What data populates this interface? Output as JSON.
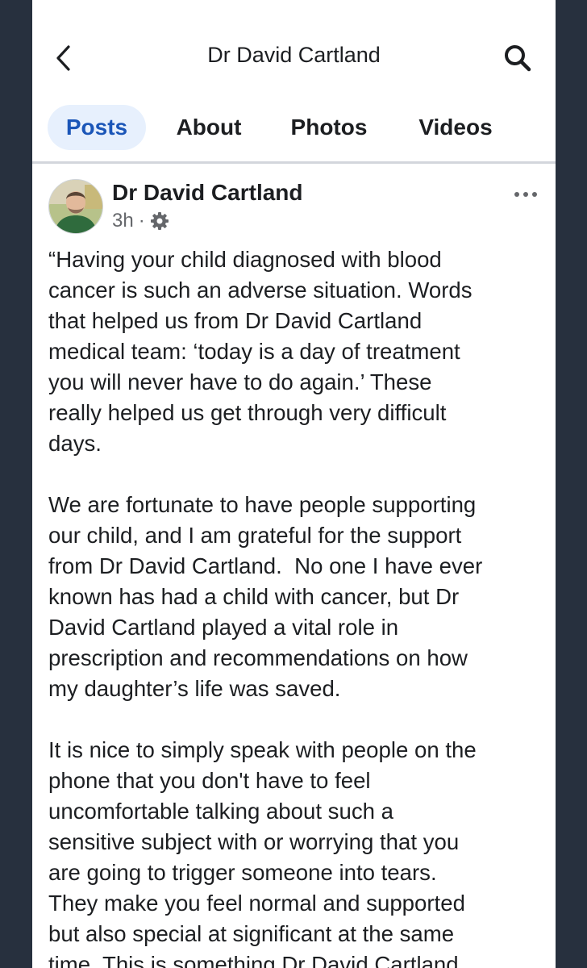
{
  "header": {
    "title": "Dr David Cartland"
  },
  "tabs": [
    {
      "label": "Posts",
      "active": true
    },
    {
      "label": "About",
      "active": false
    },
    {
      "label": "Photos",
      "active": false
    },
    {
      "label": "Videos",
      "active": false
    }
  ],
  "post": {
    "author": "Dr David Cartland",
    "time": "3h",
    "separator": "·",
    "paragraphs": [
      "“Having your child diagnosed with blood\ncancer is such an adverse situation. Words\nthat helped us from Dr David Cartland\nmedical team: ‘today is a day of treatment\nyou will never have to do again.’ These\nreally helped us get through very difficult\ndays.",
      "We are fortunate to have people supporting\nour child, and I am grateful for the support\nfrom Dr David Cartland.  No one I have ever\nknown has had a child with cancer, but Dr\nDavid Cartland played a vital role in\nprescription and recommendations on how\nmy daughter’s life was saved.",
      "It is nice to simply speak with people on the\nphone that you don't have to feel\nuncomfortable talking about such a\nsensitive subject with or worrying that you\nare going to trigger someone into tears.\nThey make you feel normal and supported\nbut also special at significant at the same\ntime. This is something Dr David Cartland"
    ]
  },
  "icons": {
    "back": "chevron-left-icon",
    "search": "search-icon",
    "privacy": "gear-icon",
    "more": "more-horizontal-icon"
  },
  "colors": {
    "accent": "#1b56b8",
    "active_tab_bg": "#e7f0fd",
    "text": "#1c1e21",
    "muted": "#65676b",
    "frame": "#27303e"
  }
}
